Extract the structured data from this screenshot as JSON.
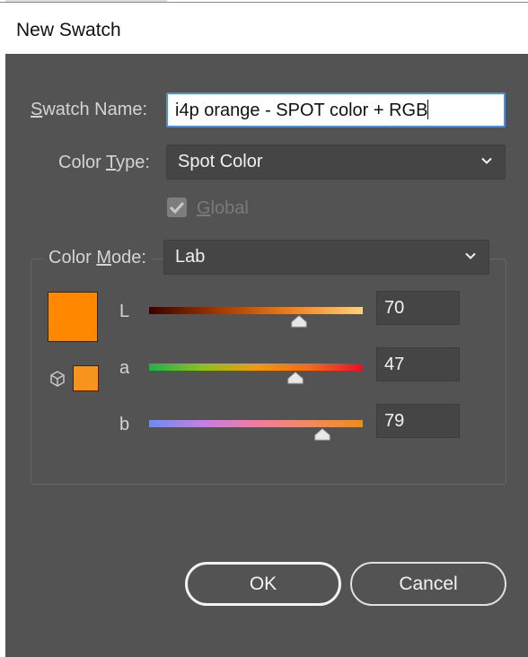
{
  "window": {
    "title": "New Swatch"
  },
  "form": {
    "swatch_name_label_mnemonic": "S",
    "swatch_name_label_rest": "watch Name:",
    "swatch_name_value": "i4p orange - SPOT color + RGB",
    "color_type_label_pre": "Color ",
    "color_type_label_mnemonic": "T",
    "color_type_label_rest": "ype:",
    "color_type_value": "Spot Color",
    "global_label_mnemonic": "G",
    "global_label_rest": "lobal",
    "global_checked": true,
    "color_mode_label_pre": "Color ",
    "color_mode_label_mnemonic": "M",
    "color_mode_label_rest": "ode:",
    "color_mode_value": "Lab"
  },
  "preview": {
    "swatch_color": "#ff8800",
    "gamut_swatch_color": "#f7941d"
  },
  "channels": [
    {
      "label": "L",
      "value": "70",
      "slider_fraction": 0.7,
      "gradient": [
        "#3a0000",
        "#a33a00",
        "#f07f1f",
        "#ffd27a"
      ]
    },
    {
      "label": "a",
      "value": "47",
      "slider_fraction": 0.685,
      "gradient": [
        "#22b04a",
        "#8dc01e",
        "#f09a10",
        "#f26a1a",
        "#e8102a"
      ]
    },
    {
      "label": "b",
      "value": "79",
      "slider_fraction": 0.81,
      "gradient": [
        "#6b8cf7",
        "#c77de6",
        "#f47aa0",
        "#f58a5a",
        "#f28a10"
      ]
    }
  ],
  "buttons": {
    "ok_label": "OK",
    "cancel_label": "Cancel"
  }
}
